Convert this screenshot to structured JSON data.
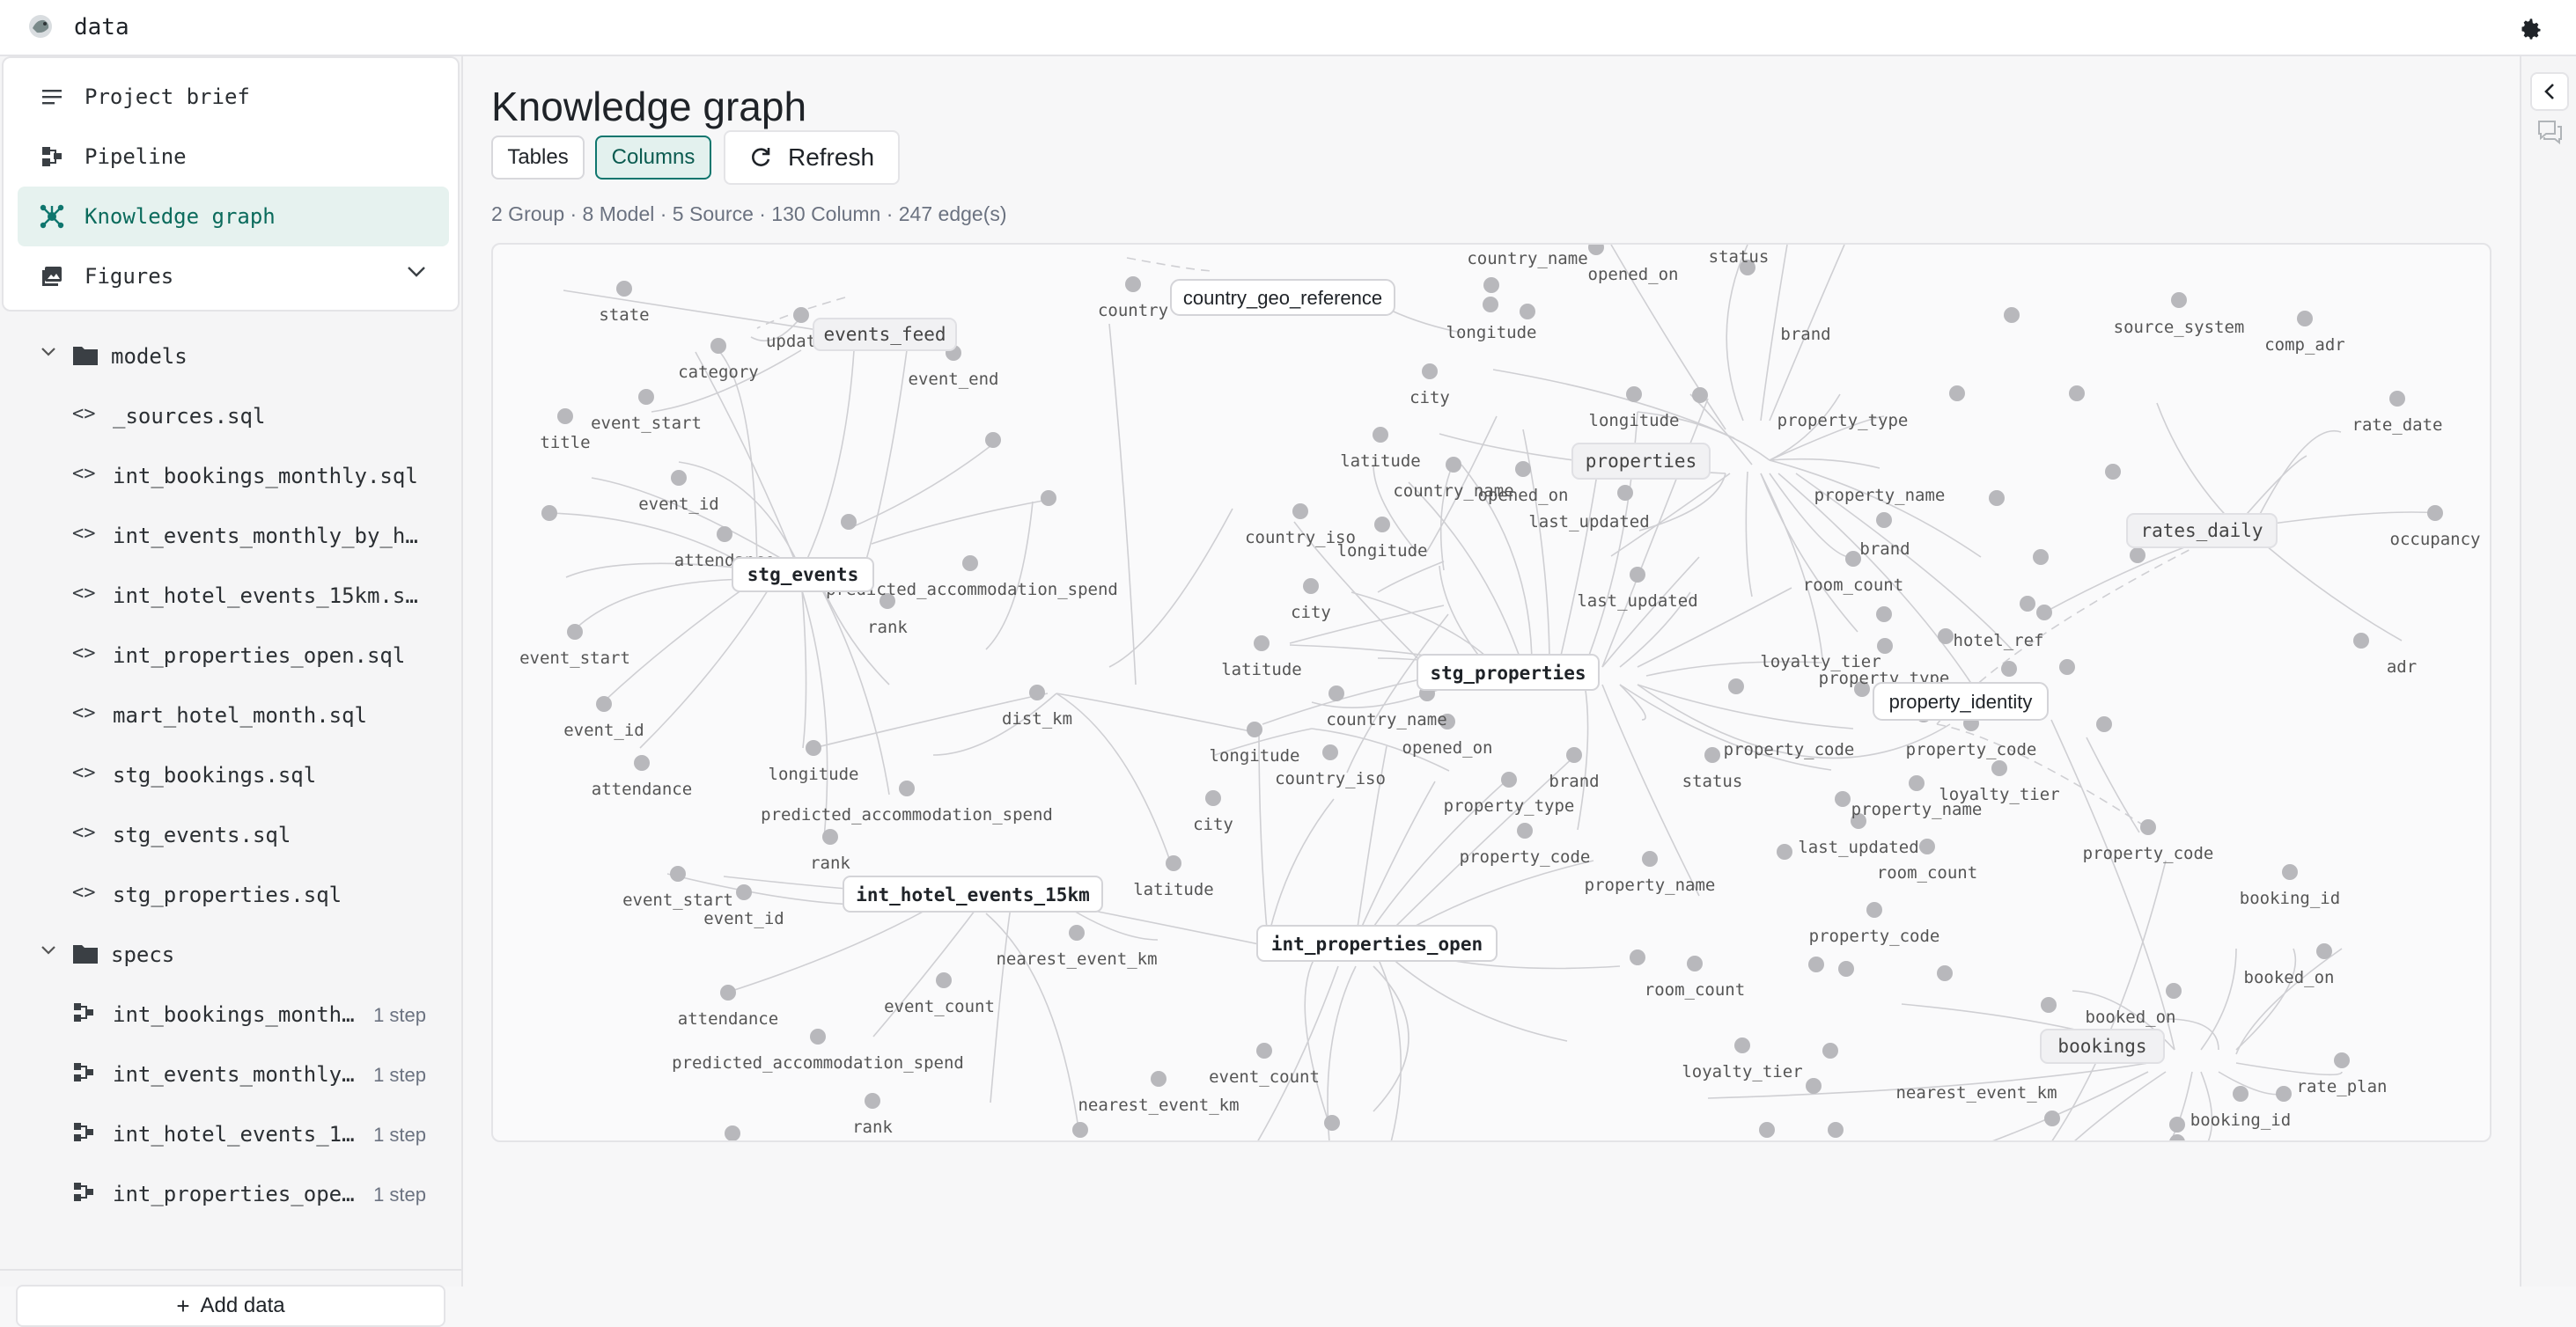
{
  "app": {
    "title": "data"
  },
  "nav": [
    {
      "label": "Project brief",
      "icon": "lines-icon"
    },
    {
      "label": "Pipeline",
      "icon": "pipeline-icon"
    },
    {
      "label": "Knowledge graph",
      "icon": "graph-icon",
      "active": true
    },
    {
      "label": "Figures",
      "icon": "image-icon",
      "expandable": true
    }
  ],
  "tree": {
    "models_folder": "models",
    "models": [
      "_sources.sql",
      "int_bookings_monthly.sql",
      "int_events_monthly_by_h…",
      "int_hotel_events_15km.s…",
      "int_properties_open.sql",
      "mart_hotel_month.sql",
      "stg_bookings.sql",
      "stg_events.sql",
      "stg_properties.sql"
    ],
    "specs_folder": "specs",
    "specs": [
      {
        "label": "int_bookings_month…",
        "steps": "1 step"
      },
      {
        "label": "int_events_monthly…",
        "steps": "1 step"
      },
      {
        "label": "int_hotel_events_1…",
        "steps": "1 step"
      },
      {
        "label": "int_properties_ope…",
        "steps": "1 step"
      }
    ],
    "add_data": "Add data"
  },
  "main": {
    "title": "Knowledge graph",
    "tabs": [
      "Tables",
      "Columns"
    ],
    "selected_tab": "Columns",
    "refresh": "Refresh",
    "stats": "2 Group · 8 Model · 5 Source · 130 Column · 247 edge(s)"
  },
  "graph": {
    "tables": [
      "stg_events",
      "stg_properties",
      "int_hotel_events_15km",
      "int_properties_open",
      "property_identity",
      "country_geo_reference"
    ],
    "groups": [
      "events_feed",
      "properties",
      "rates_daily",
      "bookings"
    ],
    "columns": [
      "state",
      "updated",
      "category",
      "title",
      "event_start",
      "event_end",
      "country",
      "country_name",
      "opened_on",
      "status",
      "longitude",
      "brand",
      "source_system",
      "comp_adr",
      "city",
      "latitude",
      "property_type",
      "rate_date",
      "property_name",
      "last_updated",
      "occupancy",
      "event_id",
      "attendance",
      "country_iso",
      "predicted_accommodation_spend",
      "rank",
      "room_count",
      "hotel_ref",
      "loyalty_tier",
      "adr",
      "dist_km",
      "property_code",
      "nearest_event_km",
      "booking_id",
      "booked_on",
      "event_count",
      "nearest_event_km",
      "rate_plan"
    ]
  },
  "colors": {
    "accent": "#0f766e",
    "active_bg": "#e6f2ef"
  }
}
